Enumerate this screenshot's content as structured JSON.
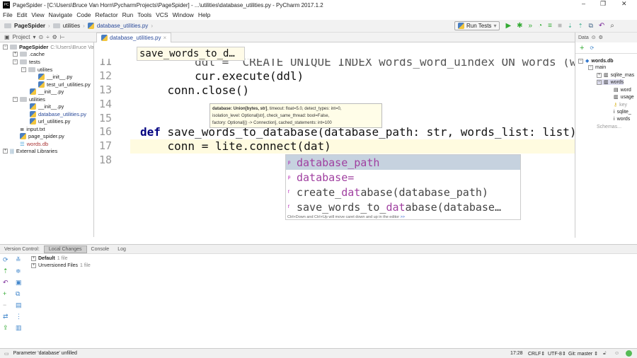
{
  "window": {
    "title": "PageSpider - [C:\\Users\\Bruce Van Horn\\PycharmProjects\\PageSpider] - ...\\utilities\\database_utilities.py - PyCharm 2017.1.2"
  },
  "menu": [
    "File",
    "Edit",
    "View",
    "Navigate",
    "Code",
    "Refactor",
    "Run",
    "Tools",
    "VCS",
    "Window",
    "Help"
  ],
  "breadcrumb": [
    "PageSpider",
    "utilities",
    "database_utilities.py"
  ],
  "toolbar": {
    "run_config": "Run Tests"
  },
  "project_panel": {
    "label": "Project",
    "file_tab": "database_utilities.py",
    "tree": [
      {
        "name": "PageSpider",
        "path": "C:\\Users\\Bruce Van"
      },
      {
        "name": ".cache"
      },
      {
        "name": "tests"
      },
      {
        "name": "utilites"
      },
      {
        "name": "__init__.py"
      },
      {
        "name": "test_url_utilities.py"
      },
      {
        "name": "__init__.py"
      },
      {
        "name": "utilities"
      },
      {
        "name": "__init__.py"
      },
      {
        "name": "database_utilities.py"
      },
      {
        "name": "url_utilities.py"
      },
      {
        "name": "input.txt"
      },
      {
        "name": "page_spider.py"
      },
      {
        "name": "words.db"
      },
      {
        "name": "External Libraries"
      }
    ]
  },
  "editor": {
    "scope_popup": "save_words_to_d…",
    "lines": [
      {
        "n": "11",
        "code": "        ddl = \"CREATE UNIQUE INDEX words_word_uindex ON words (word)\""
      },
      {
        "n": "12",
        "code": "        cur.execute(ddl)"
      },
      {
        "n": "13",
        "code": "    conn.close()"
      },
      {
        "n": "14",
        "code": ""
      },
      {
        "n": "15",
        "code": ""
      },
      {
        "n": "16",
        "code_kw": "def",
        "code": " save_words_to_database(database_path: str, words_list: list):"
      },
      {
        "n": "17",
        "code": "    conn = lite.connect(dat)"
      },
      {
        "n": "18",
        "code": ""
      }
    ],
    "tooltip": {
      "bold": "database: Union[bytes, str]",
      "l1": ", timeout: float=5.0, detect_types: int=0,",
      "l2": "isolation_level: Optional[str], check_same_thread: bool=False,",
      "l3": "factory: Optional[() -> Connection], cached_statements: int=100"
    },
    "completion": {
      "items": [
        {
          "icon": "p",
          "match": "dat",
          "rest": "abase_path",
          "pre": ""
        },
        {
          "icon": "p",
          "match": "dat",
          "rest": "abase=",
          "pre": ""
        },
        {
          "icon": "f",
          "match": "dat",
          "rest": "abase(database_path)",
          "pre": "create_"
        },
        {
          "icon": "f",
          "match": "dat",
          "rest": "abase(database…",
          "pre": "save_words_to_"
        }
      ],
      "hint": "Ctrl+Down and Ctrl+Up will move caret down and up in the editor",
      "hint_link": ">>"
    }
  },
  "database_panel": {
    "label": "Data",
    "tree": [
      "words.db",
      "main",
      "sqlite_mas",
      "words",
      "word",
      "usage",
      "key",
      "sqlite_",
      "words",
      "Schemas..."
    ]
  },
  "bottom_panel": {
    "label": "Version Control:",
    "tabs": [
      "Local Changes",
      "Console",
      "Log"
    ],
    "changelists": [
      {
        "name": "Default",
        "count": "1 file"
      },
      {
        "name": "Unversioned Files",
        "count": "1 file"
      }
    ]
  },
  "status": {
    "message": "Parameter 'database' unfilled",
    "position": "17:28",
    "line_sep": "CRLF",
    "encoding": "UTF-8",
    "vcs": "Git: master"
  }
}
